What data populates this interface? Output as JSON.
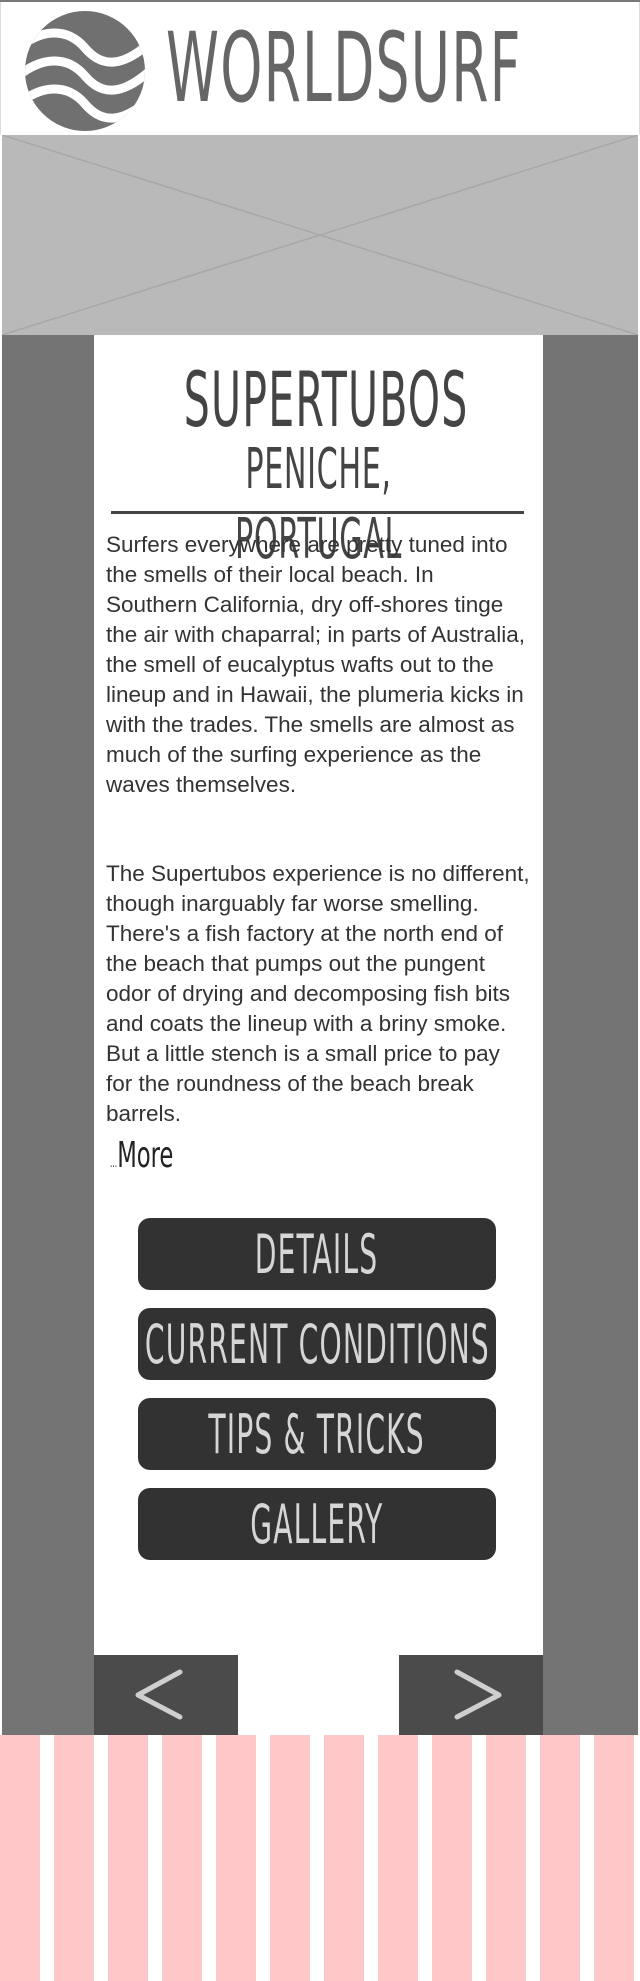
{
  "header": {
    "brand": "WORLDSURF",
    "logo_icon": "wave-globe-icon"
  },
  "hero": {
    "placeholder_icon": "image-placeholder-icon"
  },
  "spot": {
    "title": "SUPERTUBOS",
    "subtitle": "PENICHE, PORTUGAL",
    "paragraph_1": "Surfers everywhere are pretty tuned into the smells of their local beach. In Southern California, dry off-shores tinge the air with chaparral; in parts of Australia, the smell of eucalyptus wafts out to the lineup and in Hawaii, the plumeria kicks in with the trades. The smells are almost as much of the surfing experience as the waves themselves.",
    "paragraph_2": "The Supertubos experience is no different, though inarguably far worse smelling. There's a fish factory at the north end of the beach that pumps out the pungent odor of drying and decomposing fish bits and coats the lineup with a briny smoke. But a little stench is a small price to pay for the roundness of the beach break barrels.",
    "more_prefix": "...",
    "more_label": "More"
  },
  "menu": {
    "details": "DETAILS",
    "current_conditions": "CURRENT CONDITIONS",
    "tips_tricks": "TIPS & TRICKS",
    "gallery": "GALLERY"
  },
  "nav": {
    "prev_icon": "chevron-left-icon",
    "next_icon": "chevron-right-icon"
  },
  "colors": {
    "side_columns": "#747474",
    "button_bg": "#323232",
    "button_text": "#d6d6d6",
    "nav_bg": "#4b4b4b",
    "footer_stripe": "#ffc8c8",
    "hero_placeholder": "#b9b9b9"
  }
}
